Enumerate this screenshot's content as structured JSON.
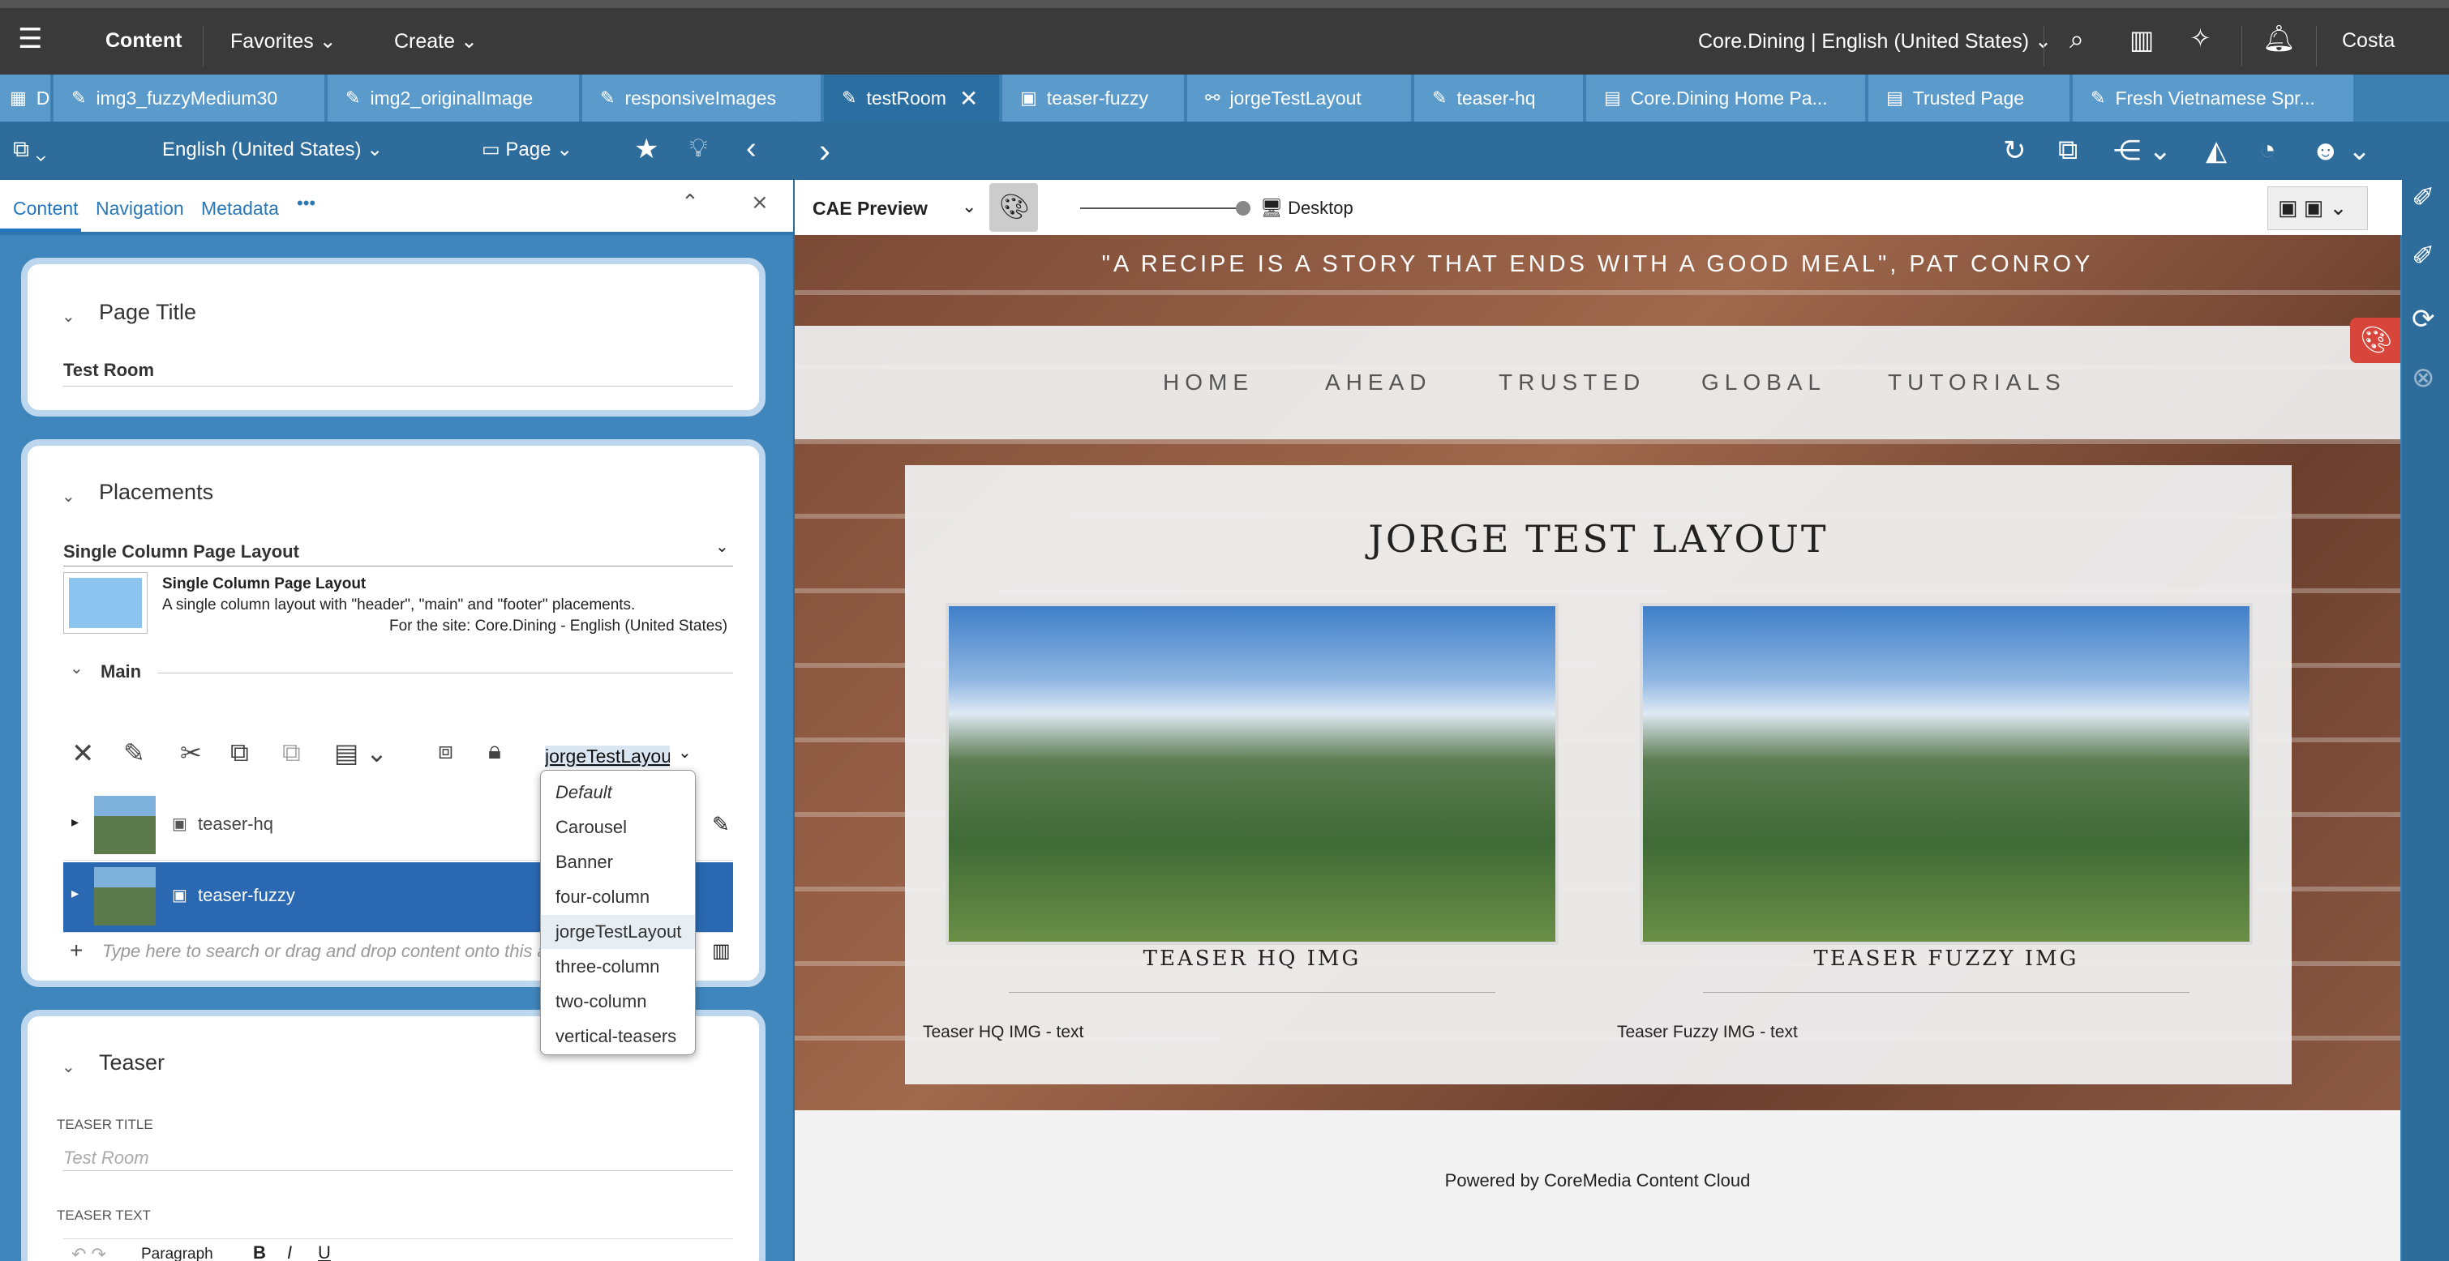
{
  "topbar": {
    "menu_icon": "hamburger-icon",
    "app": "Content",
    "favorites": "Favorites",
    "create": "Create",
    "site": "Core.Dining | English (United States)",
    "user": "Costa"
  },
  "tabs": [
    {
      "label": "D",
      "icon": "grid-icon"
    },
    {
      "label": "img3_fuzzyMedium30",
      "icon": "pencil-icon"
    },
    {
      "label": "img2_originalImage",
      "icon": "pencil-icon"
    },
    {
      "label": "responsiveImages",
      "icon": "pencil-icon"
    },
    {
      "label": "testRoom",
      "icon": "pencil-icon",
      "active": true
    },
    {
      "label": "teaser-fuzzy",
      "icon": "teaser-icon"
    },
    {
      "label": "jorgeTestLayout",
      "icon": "link-icon"
    },
    {
      "label": "teaser-hq",
      "icon": "pencil-icon"
    },
    {
      "label": "Core.Dining Home Pa...",
      "icon": "page-icon"
    },
    {
      "label": "Trusted Page",
      "icon": "page-icon"
    },
    {
      "label": "Fresh Vietnamese Spr...",
      "icon": "article-icon"
    }
  ],
  "left_toolbar": {
    "locale": "English (United States)",
    "type": "Page"
  },
  "subtabs": {
    "content": "Content",
    "navigation": "Navigation",
    "metadata": "Metadata",
    "more": "•••"
  },
  "page_title_panel": {
    "title": "Page Title",
    "value": "Test Room"
  },
  "placements_panel": {
    "title": "Placements",
    "layout_select": "Single Column Page Layout",
    "layout_name": "Single Column Page Layout",
    "layout_desc": "A single column layout with \"header\", \"main\" and \"footer\" placements.",
    "layout_site": "For the site: Core.Dining - English (United States)",
    "main_label": "Main",
    "view_type": "jorgeTestLayout",
    "items": [
      {
        "label": "teaser-hq"
      },
      {
        "label": "teaser-fuzzy"
      }
    ],
    "search_placeholder": "Type here to search or drag and drop content onto this area"
  },
  "dropdown": {
    "options": [
      "Default",
      "Carousel",
      "Banner",
      "four-column",
      "jorgeTestLayout",
      "three-column",
      "two-column",
      "vertical-teasers"
    ],
    "selected": "jorgeTestLayout"
  },
  "teaser_panel": {
    "title": "Teaser",
    "teaser_title_label": "TEASER TITLE",
    "teaser_title_placeholder": "Test Room",
    "teaser_text_label": "TEASER TEXT",
    "paragraph": "Paragraph"
  },
  "preview_toolbar": {
    "mode": "CAE Preview",
    "device": "Desktop"
  },
  "preview": {
    "quote": "\"A RECIPE IS A STORY THAT ENDS WITH A GOOD MEAL\", PAT CONROY",
    "nav": [
      "HOME",
      "AHEAD",
      "TRUSTED",
      "GLOBAL",
      "TUTORIALS"
    ],
    "heading": "JORGE TEST LAYOUT",
    "teasers": [
      {
        "title": "TEASER HQ IMG",
        "text": "Teaser HQ IMG - text"
      },
      {
        "title": "TEASER FUZZY IMG",
        "text": "Teaser Fuzzy IMG - text"
      }
    ],
    "footer": "Powered by CoreMedia Content Cloud"
  }
}
